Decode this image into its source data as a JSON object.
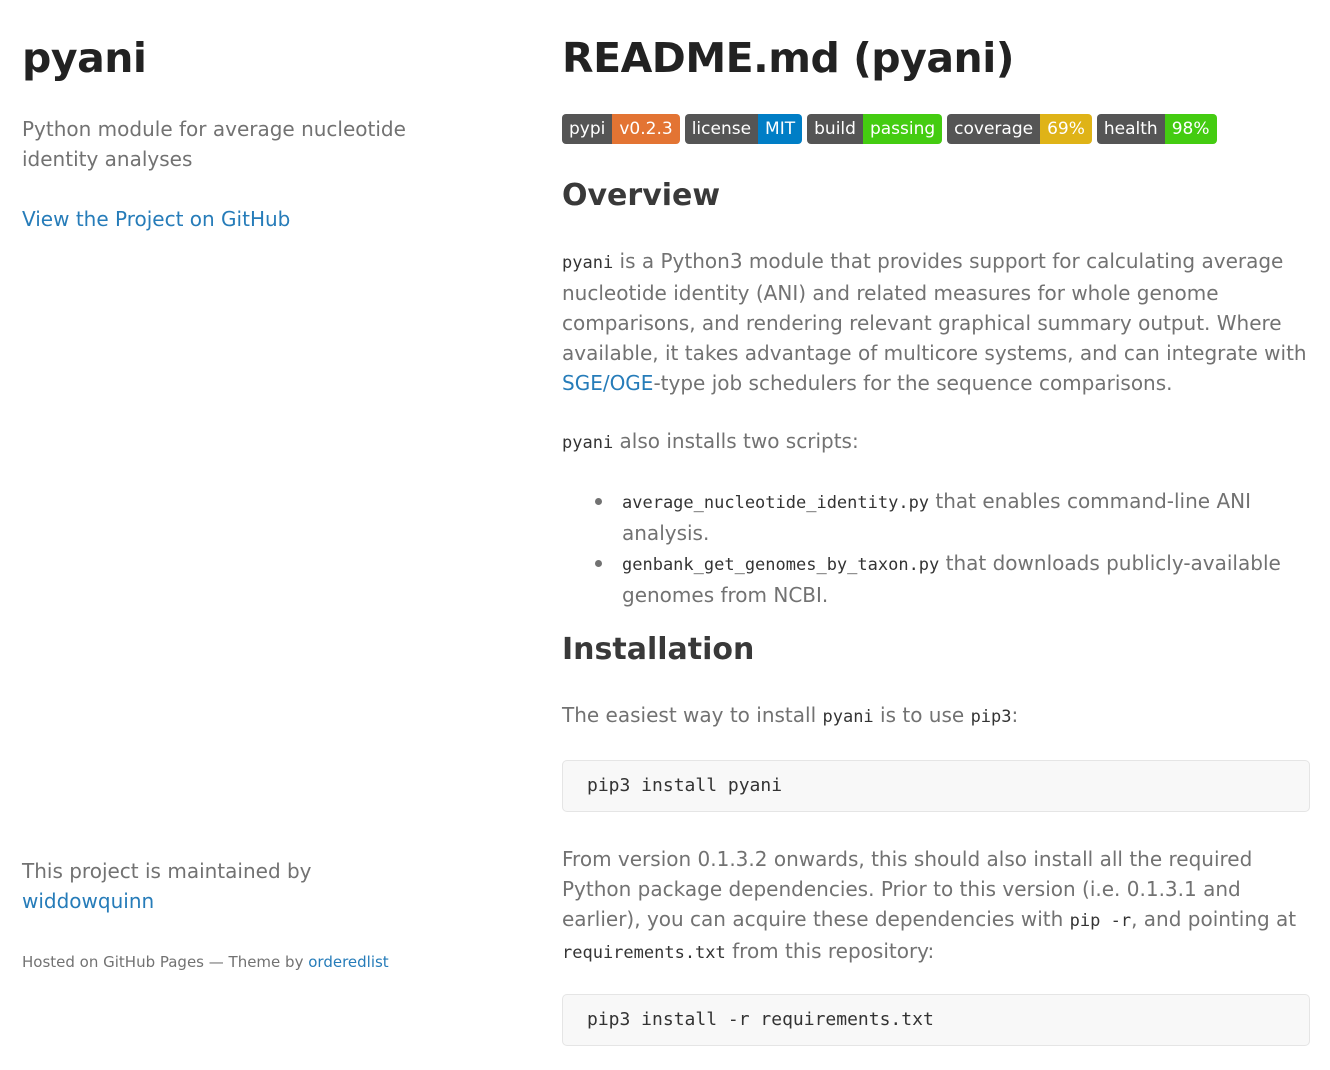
{
  "sidebar": {
    "title": "pyani",
    "description": "Python module for average nucleotide identity analyses",
    "github_link": "View the Project on GitHub",
    "maintained_prefix": "This project is maintained by",
    "maintainer": "widdowquinn",
    "hosted_prefix": "Hosted on GitHub Pages — Theme by",
    "theme_author": "orderedlist"
  },
  "main": {
    "title": "README.md (pyani)",
    "badges": [
      {
        "label": "pypi",
        "value": "v0.2.3",
        "color": "#e37433"
      },
      {
        "label": "license",
        "value": "MIT",
        "color": "#007ec6"
      },
      {
        "label": "build",
        "value": "passing",
        "color": "#44cc11"
      },
      {
        "label": "coverage",
        "value": "69%",
        "color": "#dfb317"
      },
      {
        "label": "health",
        "value": "98%",
        "color": "#44cc11"
      }
    ],
    "overview": {
      "heading": "Overview",
      "p1_code": "pyani",
      "p1_text": " is a Python3 module that provides support for calculating average nucleotide identity (ANI) and related measures for whole genome comparisons, and rendering relevant graphical summary output. Where available, it takes advantage of multicore systems, and can integrate with ",
      "p1_link": "SGE/OGE",
      "p1_tail": "-type job schedulers for the sequence comparisons.",
      "p2_code": "pyani",
      "p2_text": " also installs two scripts:",
      "scripts": [
        {
          "code": "average_nucleotide_identity.py",
          "text": " that enables command-line ANI analysis."
        },
        {
          "code": "genbank_get_genomes_by_taxon.py",
          "text": " that downloads publicly-available genomes from NCBI."
        }
      ]
    },
    "installation": {
      "heading": "Installation",
      "p1_a": "The easiest way to install ",
      "p1_code1": "pyani",
      "p1_b": " is to use ",
      "p1_code2": "pip3",
      "p1_c": ":",
      "code1": "pip3 install pyani",
      "p2_a": "From version 0.1.3.2 onwards, this should also install all the required Python package dependencies. Prior to this version (i.e. 0.1.3.1 and earlier), you can acquire these dependencies with ",
      "p2_code1": "pip -r",
      "p2_b": ", and pointing at ",
      "p2_code2": "requirements.txt",
      "p2_c": " from this repository:",
      "code2": "pip3 install -r requirements.txt"
    }
  }
}
